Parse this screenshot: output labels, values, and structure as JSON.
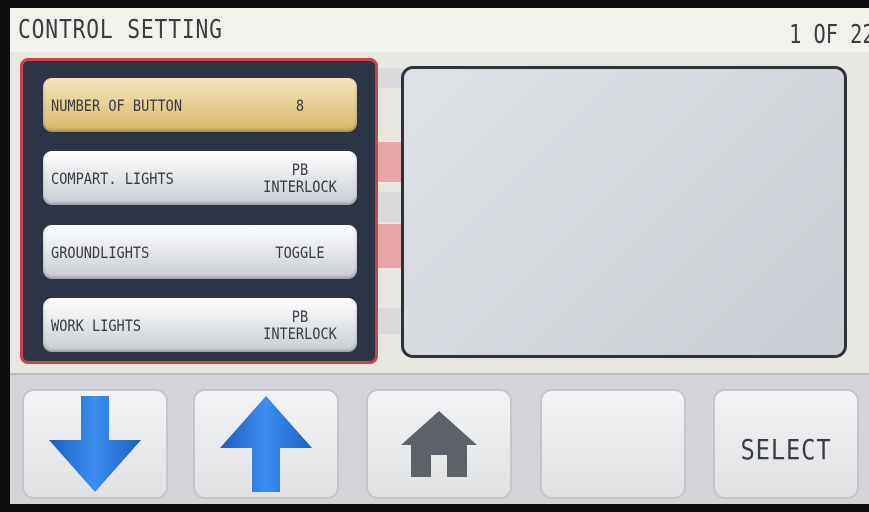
{
  "header": {
    "title": "CONTROL SETTING",
    "page_counter": "1 OF 22"
  },
  "settings": [
    {
      "label": "NUMBER OF BUTTON",
      "value_line1": "8",
      "value_line2": "",
      "selected": true
    },
    {
      "label": "COMPART. LIGHTS",
      "value_line1": "PB",
      "value_line2": "INTERLOCK",
      "selected": false
    },
    {
      "label": "GROUNDLIGHTS",
      "value_line1": "TOGGLE",
      "value_line2": "",
      "selected": false
    },
    {
      "label": "WORK LIGHTS",
      "value_line1": "PB",
      "value_line2": "INTERLOCK",
      "selected": false
    }
  ],
  "toolbar": {
    "down_icon": "arrow-down-icon",
    "up_icon": "arrow-up-icon",
    "home_icon": "home-icon",
    "select_label": "SELECT"
  },
  "colors": {
    "screen_bg": "#e9e7e2",
    "panel_bg": "#2c3446",
    "panel_border": "#c9444a",
    "selected_button": "#d8b76c",
    "arrow_blue": "#1f6fd0",
    "home_gray": "#5d6168"
  }
}
